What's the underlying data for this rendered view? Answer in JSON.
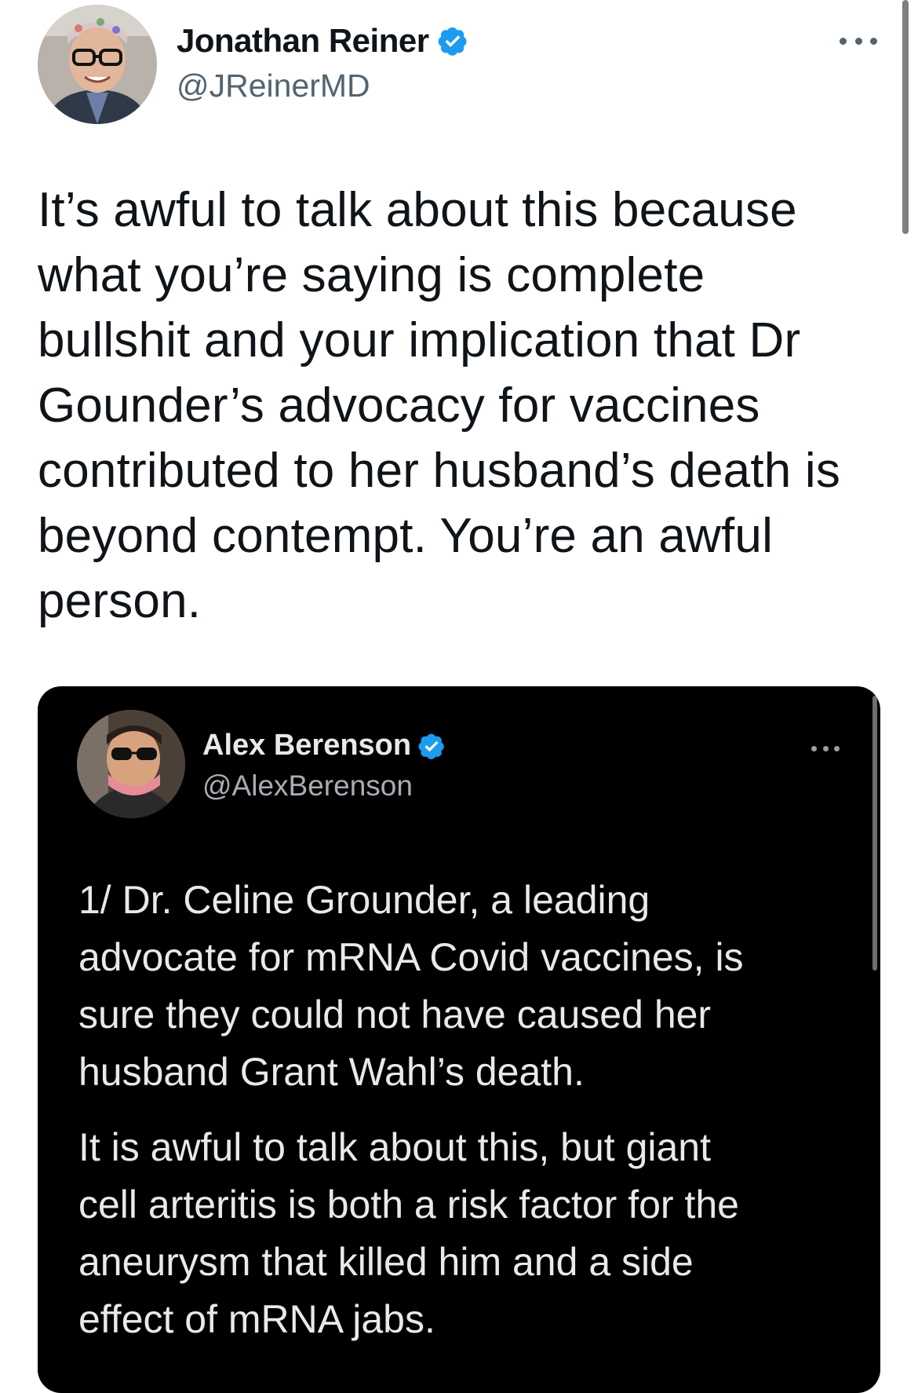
{
  "tweet": {
    "author": {
      "display_name": "Jonathan Reiner",
      "handle": "@JReinerMD",
      "verified": true,
      "avatar_icon": "profile-photo"
    },
    "more_icon": "more-options-icon",
    "text_lines": [
      "It’s awful to talk about this because",
      "what you’re saying is complete",
      "bullshit and your implication that Dr",
      "Gounder’s advocacy for vaccines",
      "contributed to her husband’s death is",
      "beyond contempt. You’re an awful",
      "person."
    ]
  },
  "quoted_screenshot": {
    "author": {
      "display_name": "Alex Berenson",
      "handle": "@AlexBerenson",
      "verified": true,
      "avatar_icon": "profile-photo"
    },
    "more_icon": "more-options-icon",
    "paragraph1_lines": [
      "1/ Dr. Celine Grounder, a leading",
      "advocate for mRNA Covid vaccines, is",
      "sure they could not have caused her",
      "husband Grant Wahl’s death."
    ],
    "paragraph2_lines": [
      "It is awful to talk about this, but giant",
      "cell arteritis is both a risk factor for the",
      "aneurysm that killed him and a side",
      "effect of mRNA jabs."
    ]
  },
  "colors": {
    "verified_badge": "#1d9bf0",
    "text_primary": "#0f1419",
    "text_secondary": "#536471",
    "embed_background": "#000000",
    "embed_text": "#e7e9ea"
  }
}
